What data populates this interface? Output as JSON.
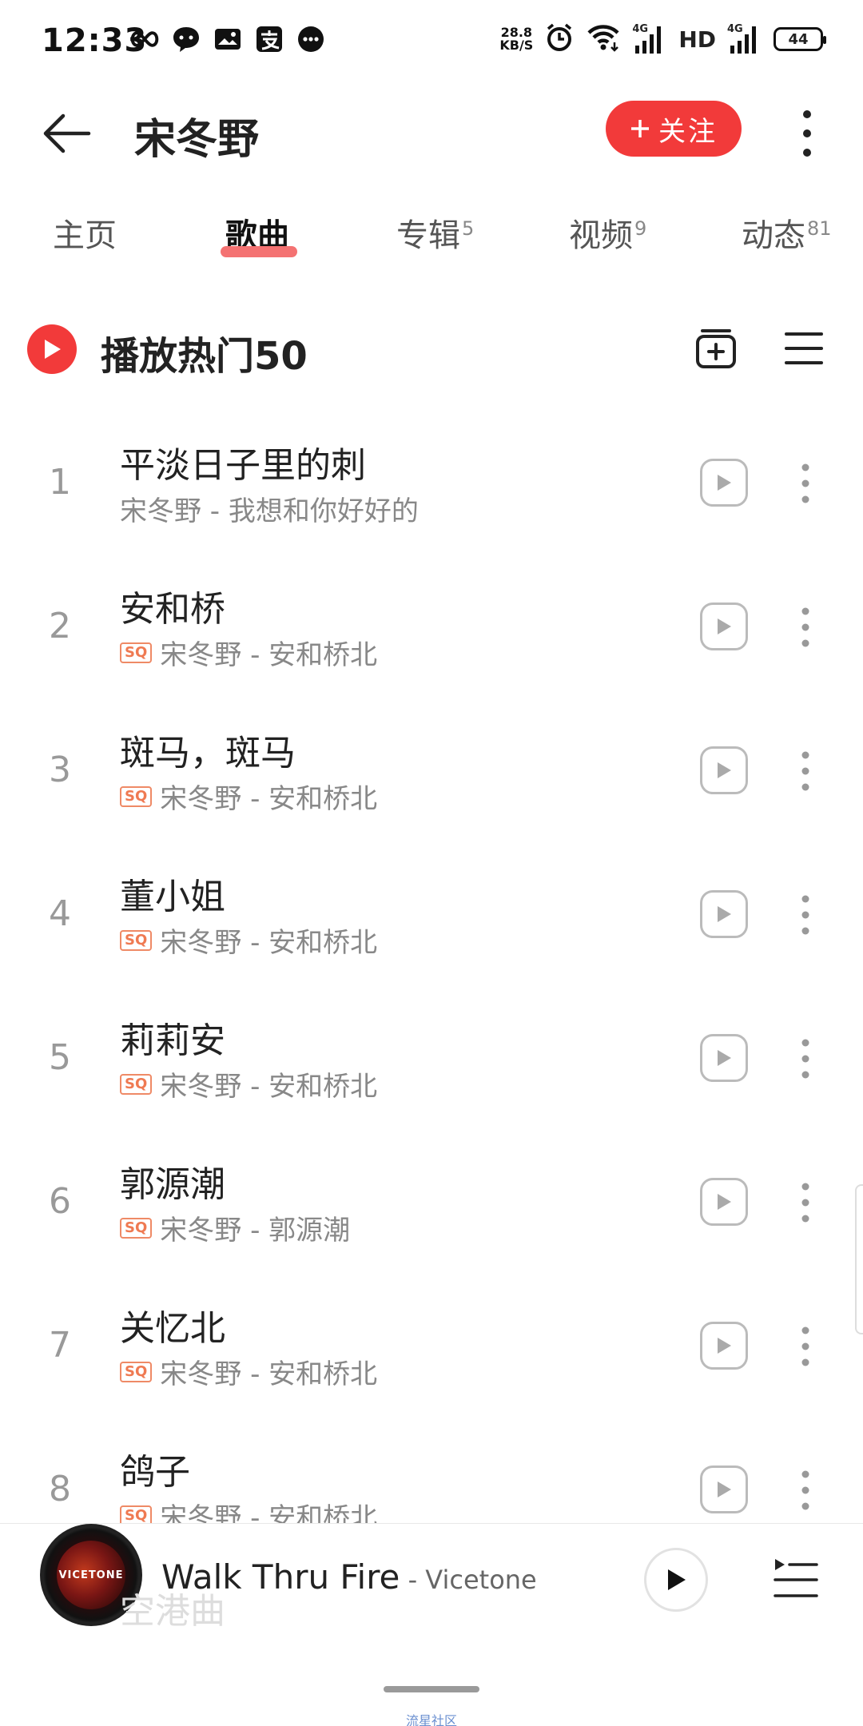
{
  "status_bar": {
    "time": "12:33",
    "net_speed_value": "28.8",
    "net_speed_unit": "KB/S",
    "battery": "44",
    "signal_label_1": "4G",
    "hd_label": "HD",
    "signal_label_2": "4G"
  },
  "header": {
    "title": "宋冬野",
    "follow_label": "关注"
  },
  "tabs": [
    {
      "label": "主页",
      "count": ""
    },
    {
      "label": "歌曲",
      "count": ""
    },
    {
      "label": "专辑",
      "count": "5"
    },
    {
      "label": "视频",
      "count": "9"
    },
    {
      "label": "动态",
      "count": "81"
    }
  ],
  "section": {
    "title": "播放热门50"
  },
  "songs": [
    {
      "num": "1",
      "title": "平淡日子里的刺",
      "artist_album": "宋冬野 - 我想和你好好的",
      "sq": ""
    },
    {
      "num": "2",
      "title": "安和桥",
      "artist_album": "宋冬野 - 安和桥北",
      "sq": "SQ"
    },
    {
      "num": "3",
      "title": "斑马，斑马",
      "artist_album": "宋冬野 - 安和桥北",
      "sq": "SQ"
    },
    {
      "num": "4",
      "title": "董小姐",
      "artist_album": "宋冬野 - 安和桥北",
      "sq": "SQ"
    },
    {
      "num": "5",
      "title": "莉莉安",
      "artist_album": "宋冬野 - 安和桥北",
      "sq": "SQ"
    },
    {
      "num": "6",
      "title": "郭源潮",
      "artist_album": "宋冬野 - 郭源潮",
      "sq": "SQ"
    },
    {
      "num": "7",
      "title": "关忆北",
      "artist_album": "宋冬野 - 安和桥北",
      "sq": "SQ"
    },
    {
      "num": "8",
      "title": "鸽子",
      "artist_album": "宋冬野 - 安和桥北",
      "sq": "SQ"
    }
  ],
  "now_playing": {
    "title": "Walk Thru Fire",
    "artist": " - Vicetone",
    "cover_text": "VICETONE"
  },
  "behind_player_text": "空港曲",
  "bottom_caption": "流星社区",
  "colors": {
    "accent": "#f23a3a",
    "tab_underline": "#f47272",
    "sq_badge": "#ef7a52"
  }
}
